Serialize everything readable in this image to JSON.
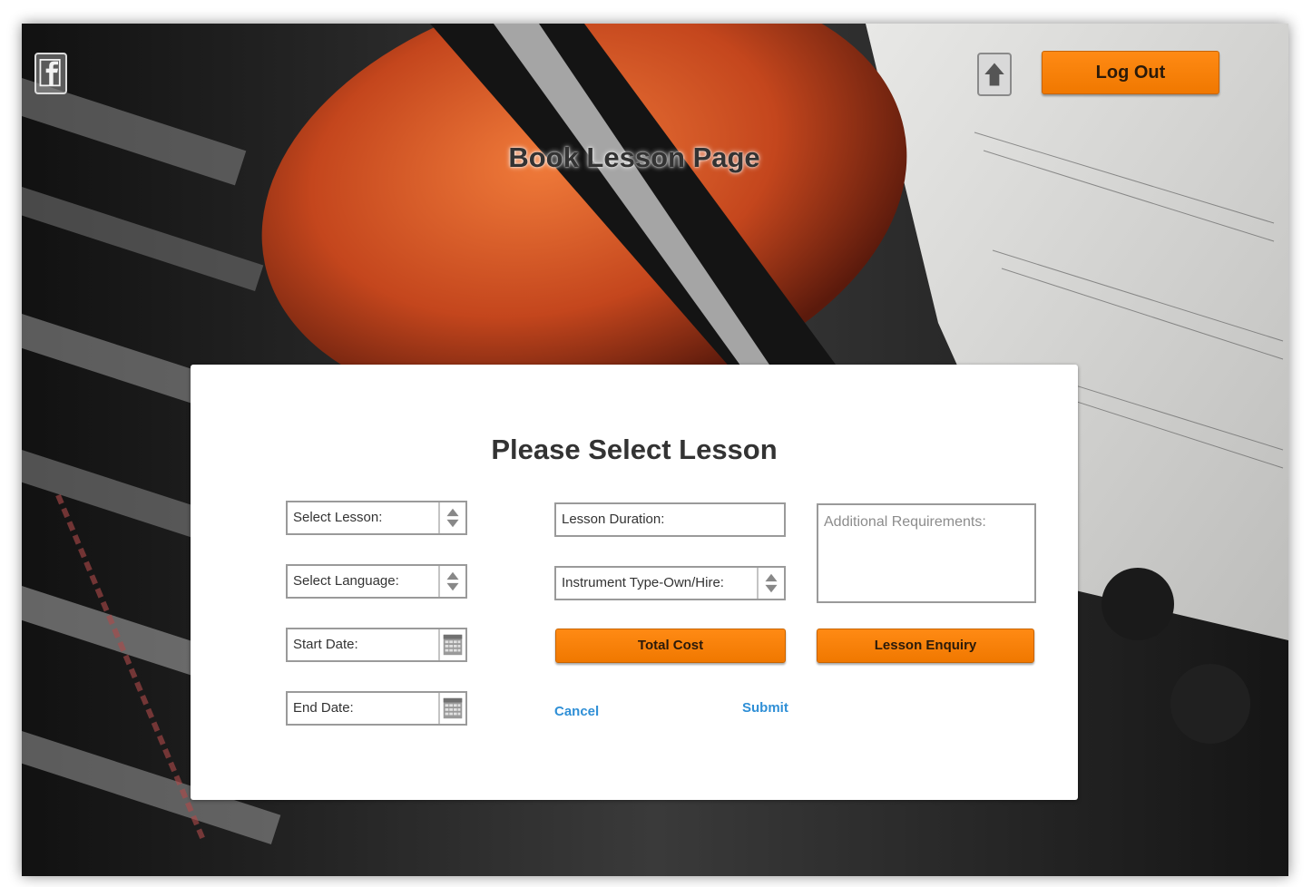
{
  "header": {
    "page_title": "Book Lesson Page",
    "logout_label": "Log Out",
    "facebook_icon": "facebook-icon",
    "home_icon": "home-icon"
  },
  "form": {
    "title": "Please Select Lesson",
    "select_lesson": {
      "label": "Select Lesson:"
    },
    "select_language": {
      "label": "Select Language:"
    },
    "start_date": {
      "label": "Start Date:"
    },
    "end_date": {
      "label": "End Date:"
    },
    "lesson_duration": {
      "label": "Lesson Duration:"
    },
    "instrument_type": {
      "label": "Instrument Type-Own/Hire:"
    },
    "additional_requirements": {
      "placeholder": "Additional Requirements:"
    },
    "total_cost_label": "Total Cost",
    "lesson_enquiry_label": "Lesson Enquiry",
    "cancel_label": "Cancel",
    "submit_label": "Submit"
  },
  "colors": {
    "accent": "#f57f00",
    "link": "#2f8fd6"
  }
}
